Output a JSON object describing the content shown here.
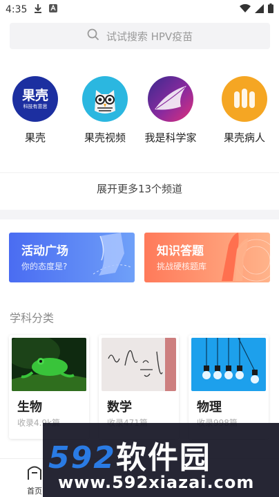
{
  "status_bar": {
    "time": "4:35"
  },
  "search": {
    "placeholder": "试试搜索 HPV疫苗"
  },
  "channels": [
    {
      "label": "果壳",
      "logo_text": "果壳",
      "logo_sub": "科技有意思",
      "color": "#1c2fa0"
    },
    {
      "label": "果壳视频",
      "color": "#2bb7e0"
    },
    {
      "label": "我是科学家",
      "color": "#6a2a9e"
    },
    {
      "label": "果壳病人",
      "color": "#f5a623"
    }
  ],
  "more_channels": "展开更多13个频道",
  "banners": [
    {
      "title": "活动广场",
      "subtitle": "你的态度是?",
      "color": "#4a6cf2"
    },
    {
      "title": "知识答题",
      "subtitle": "挑战硬核题库",
      "color": "#ff7a5a"
    }
  ],
  "section_title": "学科分类",
  "subjects": [
    {
      "name": "生物",
      "count": "收录4.9k篇"
    },
    {
      "name": "数学",
      "count": "收录471篇"
    },
    {
      "name": "物理",
      "count": "收录998篇"
    }
  ],
  "tabbar": {
    "home_label": "首页"
  },
  "watermark": {
    "logo_num": "592",
    "logo_cn": "软件园",
    "url": "www.592xiazai.com"
  }
}
